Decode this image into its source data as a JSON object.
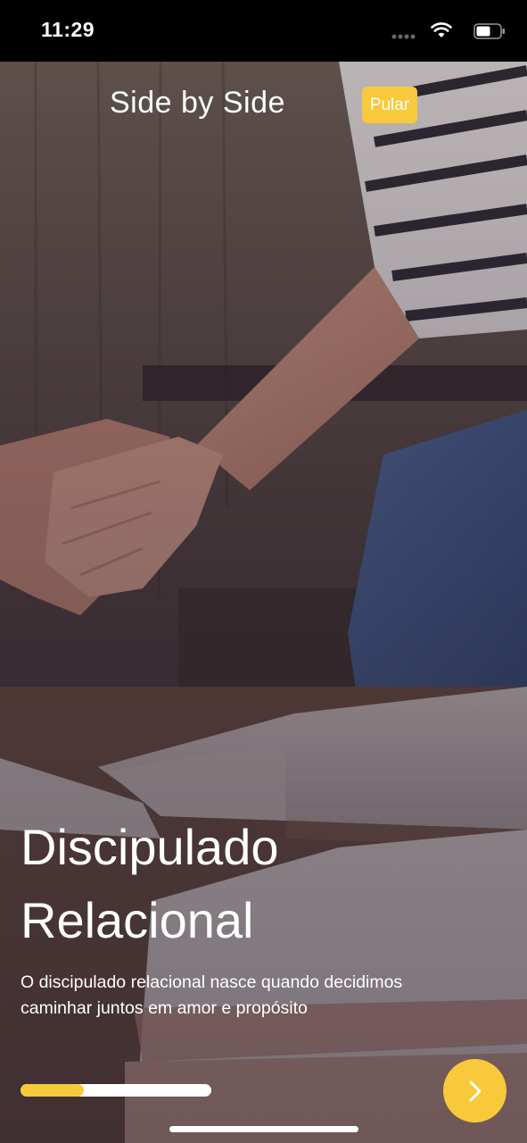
{
  "status_bar": {
    "time": "11:29",
    "icons": [
      "signal-dots-icon",
      "wifi-icon",
      "battery-icon"
    ]
  },
  "header": {
    "app_title": "Side by Side",
    "skip_label": "Pular"
  },
  "content": {
    "headline_line1": "Discipulado",
    "headline_line2": "Relacional",
    "description_line1": "O discipulado relacional nasce quando decidimos",
    "description_line2": "caminhar juntos em amor e propósito"
  },
  "progress": {
    "fraction": 0.33
  },
  "colors": {
    "accent": "#f8c93a",
    "text": "#ffffff",
    "status_bar_bg": "#000000"
  },
  "next_button": {
    "icon": "chevron-right-icon"
  }
}
